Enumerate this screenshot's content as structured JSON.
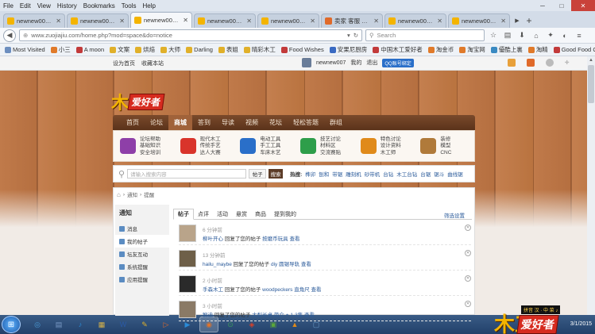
{
  "menubar": {
    "items": [
      "File",
      "Edit",
      "View",
      "History",
      "Bookmarks",
      "Tools",
      "Help"
    ]
  },
  "tabs": [
    {
      "label": "newnew007 - ...",
      "color": "#f4b400"
    },
    {
      "label": "newnew007 - ...",
      "color": "#f4b400"
    },
    {
      "label": "newnew007 - ...",
      "color": "#f4b400",
      "active": true
    },
    {
      "label": "newnew007 - ...",
      "color": "#f4b400"
    },
    {
      "label": "newnew007 - ...",
      "color": "#f4b400"
    },
    {
      "label": "卖家 客服 请问 ...",
      "color": "#e06a2a"
    },
    {
      "label": "newnew007 - ...",
      "color": "#f4b400"
    },
    {
      "label": "newnew007 - ...",
      "color": "#f4b400"
    }
  ],
  "nav": {
    "url": "www.zuojiajiu.com/home.php?mod=space&do=notice",
    "search_placeholder": "Search"
  },
  "bookmarks": [
    {
      "label": "Most Visited",
      "color": "#6c8ebf"
    },
    {
      "label": "小三",
      "color": "#e07a2a"
    },
    {
      "label": "A moon",
      "color": "#c23a3a"
    },
    {
      "label": "文案",
      "color": "#e0b02a"
    },
    {
      "label": "烘焙",
      "color": "#e0b02a"
    },
    {
      "label": "大师",
      "color": "#e0b02a"
    },
    {
      "label": "Darling",
      "color": "#e0b02a"
    },
    {
      "label": "表姐",
      "color": "#e0b02a"
    },
    {
      "label": "晴彩木工",
      "color": "#e0b02a"
    },
    {
      "label": "Food Wishes",
      "color": "#c23a3a"
    },
    {
      "label": "安果尼厨房",
      "color": "#3a6ac2"
    },
    {
      "label": "中国木工爱好者",
      "color": "#c23a3a"
    },
    {
      "label": "淘金币",
      "color": "#e07a2a"
    },
    {
      "label": "淘宝网",
      "color": "#e07a2a"
    },
    {
      "label": "優酷上裏",
      "color": "#3a8ac2"
    },
    {
      "label": "淘精",
      "color": "#e07a2a"
    },
    {
      "label": "Good Food Channel",
      "color": "#c23a3a"
    }
  ],
  "sitebar": {
    "left_links": [
      "设为首页",
      "收藏本站"
    ],
    "username": "newnew007",
    "links": [
      "我的",
      "退出"
    ],
    "badge": "QQ账号绑定"
  },
  "logo": {
    "mark": "木工",
    "name": "爱好者"
  },
  "mainnav": [
    "首页",
    "论坛",
    "商城",
    "答到",
    "导读",
    "视频",
    "花坛",
    "轻松答题",
    "群组"
  ],
  "mainnav_active": 2,
  "categories": [
    {
      "lines": [
        "论坛帮助",
        "基础知识",
        "安全培训"
      ],
      "color": "#8e3fa8"
    },
    {
      "lines": [
        "现代木工",
        "传统手艺",
        "达人大赛"
      ],
      "color": "#d9342b"
    },
    {
      "lines": [
        "电动工具",
        "手工工具",
        "车床木艺"
      ],
      "color": "#2a6fc9"
    },
    {
      "lines": [
        "技艺讨论",
        "材料区",
        "交流赛贴"
      ],
      "color": "#2e9e4a"
    },
    {
      "lines": [
        "特色讨论",
        "设计资料",
        "木工师"
      ],
      "color": "#e08a1a"
    },
    {
      "lines": [
        "装修",
        "模型",
        "CNC"
      ],
      "color": "#b07a3a"
    }
  ],
  "search": {
    "placeholder": "请输入搜索内容",
    "type_label": "帖子",
    "button_label": "搜索",
    "hot_label": "热搜:",
    "hot_terms": [
      "榫卯",
      "刨和",
      "带锯",
      "雕刻机",
      "砂带机",
      "台钻",
      "木工台钻",
      "台锯",
      "锯斗",
      "曲线锯"
    ]
  },
  "breadcrumb": {
    "items": [
      "通知",
      "提醒"
    ],
    "sep": "›"
  },
  "sidebar": {
    "heading": "通知",
    "items": [
      {
        "label": "消息",
        "color": "#5b8cc2"
      },
      {
        "label": "我的帖子",
        "color": "#5b8cc2",
        "active": true
      },
      {
        "label": "坛友互动",
        "color": "#5b8cc2"
      },
      {
        "label": "系统提醒",
        "color": "#5b8cc2"
      },
      {
        "label": "应用提醒",
        "color": "#5b8cc2"
      }
    ]
  },
  "content_tabs": [
    "帖子",
    "点评",
    "活动",
    "悬赏",
    "商品",
    "提到我的"
  ],
  "content_tabs_active": 0,
  "filter_label": "筛选设置",
  "notices": [
    {
      "time": "6 分钟前",
      "user": "柳叶开心",
      "action": "回复了您的帖子",
      "title": "按磨币玩具",
      "view": "查看",
      "avatar": "#b9a48a"
    },
    {
      "time": "13 分钟前",
      "user": "hailu_maybe",
      "action": "回复了您的帖子",
      "title": "diy 圆锯导轨",
      "view": "查看",
      "avatar": "#6e5f48"
    },
    {
      "time": "2 小时前",
      "user": "手森木工",
      "action": "回复了您的帖子",
      "title": "woodpeckers 直角尺",
      "view": "查看",
      "avatar": "#2a2a2a"
    },
    {
      "time": "3 小时前",
      "user": "猴迪",
      "action": "回复了您的帖子",
      "title": "大梨长桌 简介 + 1-3集",
      "view": "查看",
      "avatar": "#8a7a66"
    }
  ],
  "taskbar": {
    "apps": [
      {
        "icon": "◎",
        "color": "#4a9ad6"
      },
      {
        "icon": "▤",
        "color": "#7a9ac6"
      },
      {
        "icon": "♪",
        "color": "#2a8ad6"
      },
      {
        "icon": "▦",
        "color": "#d6b24a"
      },
      {
        "icon": "W",
        "color": "#2a5aa6"
      },
      {
        "icon": "✎",
        "color": "#e0b02a"
      },
      {
        "icon": "▷",
        "color": "#e06a2a"
      },
      {
        "icon": "▶",
        "color": "#2a8ad6"
      },
      {
        "icon": "◉",
        "color": "#e0732a",
        "active": true
      },
      {
        "icon": "⊙",
        "color": "#3a9a5a"
      },
      {
        "icon": "◈",
        "color": "#d6402a"
      },
      {
        "icon": "▣",
        "color": "#5aa63a"
      },
      {
        "icon": "▲",
        "color": "#e08a1a"
      },
      {
        "icon": "▢",
        "color": "#6a9ac6"
      }
    ],
    "tray_text": "拼音 汉 · 中 菜 ♪",
    "clock_time": "",
    "clock_date": "3/1/2015"
  },
  "watermark": {
    "mark": "木工",
    "name": "爱好者"
  }
}
